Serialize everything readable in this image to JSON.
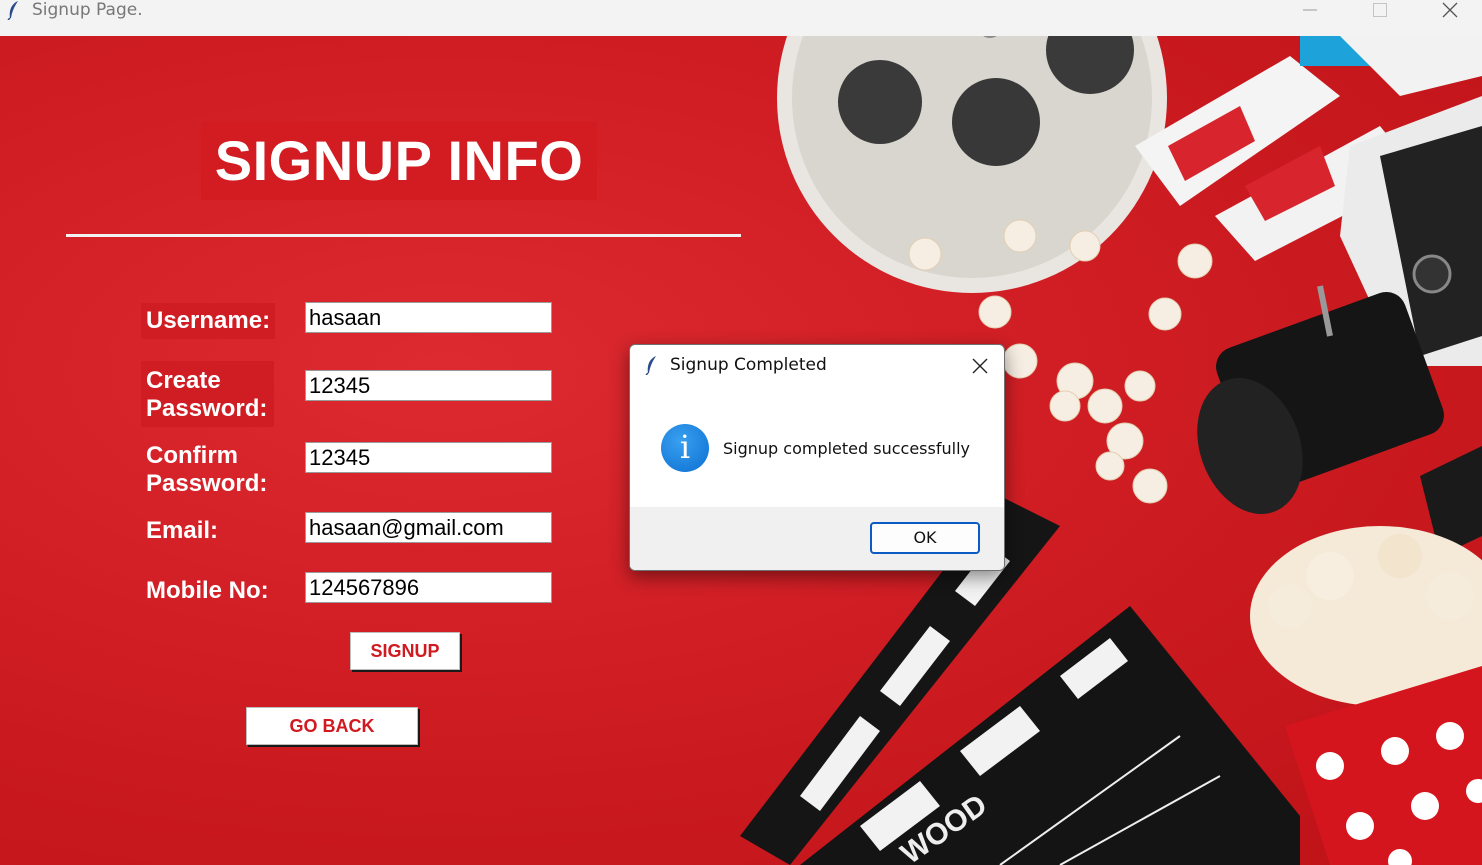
{
  "window": {
    "title": "Signup Page.",
    "icon": "feather-icon",
    "controls": [
      "minimize-icon",
      "maximize-icon",
      "close-icon"
    ]
  },
  "form": {
    "heading": "SIGNUP INFO",
    "fields": [
      {
        "label": "Username:",
        "value": "hasaan"
      },
      {
        "label": "Create\nPassword:",
        "value": "12345"
      },
      {
        "label": "Confirm\nPassword:",
        "value": "12345"
      },
      {
        "label": "Email:",
        "value": "hasaan@gmail.com"
      },
      {
        "label": "Mobile No:",
        "value": "124567896"
      }
    ],
    "signup_label": "SIGNUP",
    "goback_label": "GO BACK"
  },
  "dialog": {
    "title": "Signup Completed",
    "icon": "info-icon",
    "message": "Signup completed successfully",
    "ok_label": "OK"
  },
  "colors": {
    "background": "#c8161c",
    "button_text": "#d1191f",
    "dialog_accent": "#0a5bc4",
    "info_icon": "#1a82e2"
  }
}
